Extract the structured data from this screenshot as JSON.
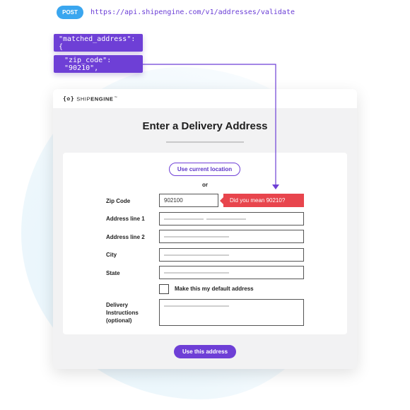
{
  "request": {
    "method": "POST",
    "url": "https://api.shipengine.com/v1/addresses/validate"
  },
  "response": {
    "line1": "\"matched_address\": {",
    "line2": "\"zip_code\": \"90210\","
  },
  "brand": {
    "mark": "{✿}",
    "name_light": "SHIP",
    "name_bold": "ENGINE",
    "tm": "™"
  },
  "form": {
    "title": "Enter a Delivery Address",
    "use_location_label": "Use current location",
    "or_label": "or",
    "fields": {
      "zip": {
        "label": "Zip Code",
        "value": "902100"
      },
      "address1": {
        "label": "Address line 1"
      },
      "address2": {
        "label": "Address line 2"
      },
      "city": {
        "label": "City"
      },
      "state": {
        "label": "State"
      },
      "instructions": {
        "label": "Delivery Instructions (optional)"
      }
    },
    "suggestion": "Did you mean 90210?",
    "default_checkbox_label": "Make this my default address",
    "submit_label": "Use this address"
  },
  "colors": {
    "brand_purple": "#6e3fd6",
    "method_blue": "#3aa6ef",
    "error_red": "#e8454d"
  }
}
